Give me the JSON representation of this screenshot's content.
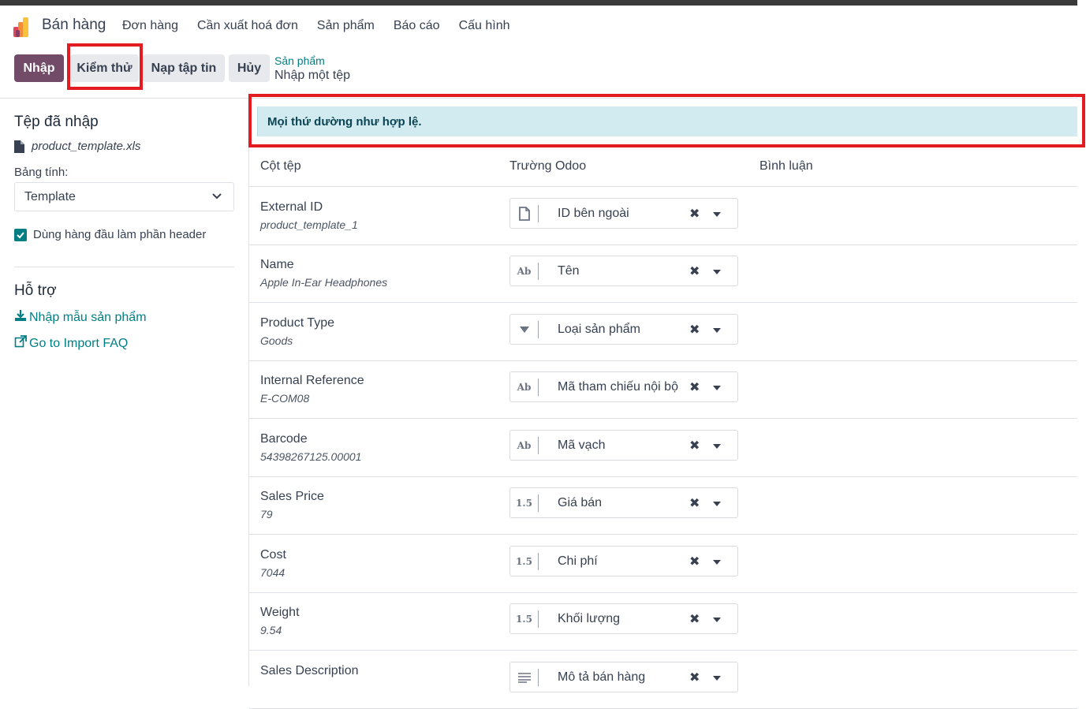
{
  "navbar": {
    "app_name": "Bán hàng",
    "menu": [
      "Đơn hàng",
      "Cần xuất hoá đơn",
      "Sản phẩm",
      "Báo cáo",
      "Cấu hình"
    ]
  },
  "control": {
    "import_label": "Nhập",
    "test_label": "Kiểm thử",
    "load_label": "Nạp tập tin",
    "cancel_label": "Hủy",
    "breadcrumb_parent": "Sản phẩm",
    "breadcrumb_current": "Nhập một tệp"
  },
  "sidebar": {
    "imported_title": "Tệp đã nhập",
    "file_name": "product_template.xls",
    "sheet_label": "Bảng tính:",
    "sheet_value": "Template",
    "header_checkbox_label": "Dùng hàng đầu làm phần header",
    "header_checkbox_checked": true,
    "help_title": "Hỗ trợ",
    "help_links": [
      "Nhập mẫu sản phẩm",
      "Go to Import FAQ"
    ]
  },
  "main": {
    "alert": "Mọi thứ dường như hợp lệ.",
    "columns": [
      "Cột tệp",
      "Trường Odoo",
      "Bình luận"
    ],
    "rows": [
      {
        "name": "External ID",
        "sample": "product_template_1",
        "icon": "file-icon",
        "type_text": "",
        "field": "ID bên ngoài"
      },
      {
        "name": "Name",
        "sample": "Apple In-Ear Headphones",
        "icon": "text-type-icon",
        "type_text": "Ab",
        "field": "Tên"
      },
      {
        "name": "Product Type",
        "sample": "Goods",
        "icon": "selection-type-icon",
        "type_text": "",
        "field": "Loại sản phẩm"
      },
      {
        "name": "Internal Reference",
        "sample": "E-COM08",
        "icon": "text-type-icon",
        "type_text": "Ab",
        "field": "Mã tham chiếu nội bộ"
      },
      {
        "name": "Barcode",
        "sample": "54398267125.00001",
        "icon": "text-type-icon",
        "type_text": "Ab",
        "field": "Mã vạch"
      },
      {
        "name": "Sales Price",
        "sample": "79",
        "icon": "float-type-icon",
        "type_text": "1.5",
        "field": "Giá bán"
      },
      {
        "name": "Cost",
        "sample": "7044",
        "icon": "float-type-icon",
        "type_text": "1.5",
        "field": "Chi phí"
      },
      {
        "name": "Weight",
        "sample": "9.54",
        "icon": "float-type-icon",
        "type_text": "1.5",
        "field": "Khối lượng"
      },
      {
        "name": "Sales Description",
        "sample": "",
        "icon": "html-type-icon",
        "type_text": "",
        "field": "Mô tả bán hàng"
      }
    ]
  },
  "colors": {
    "primary": "#714b67",
    "link": "#017e84",
    "alert_bg": "#d2ebf0",
    "highlight": "#e31b23"
  }
}
